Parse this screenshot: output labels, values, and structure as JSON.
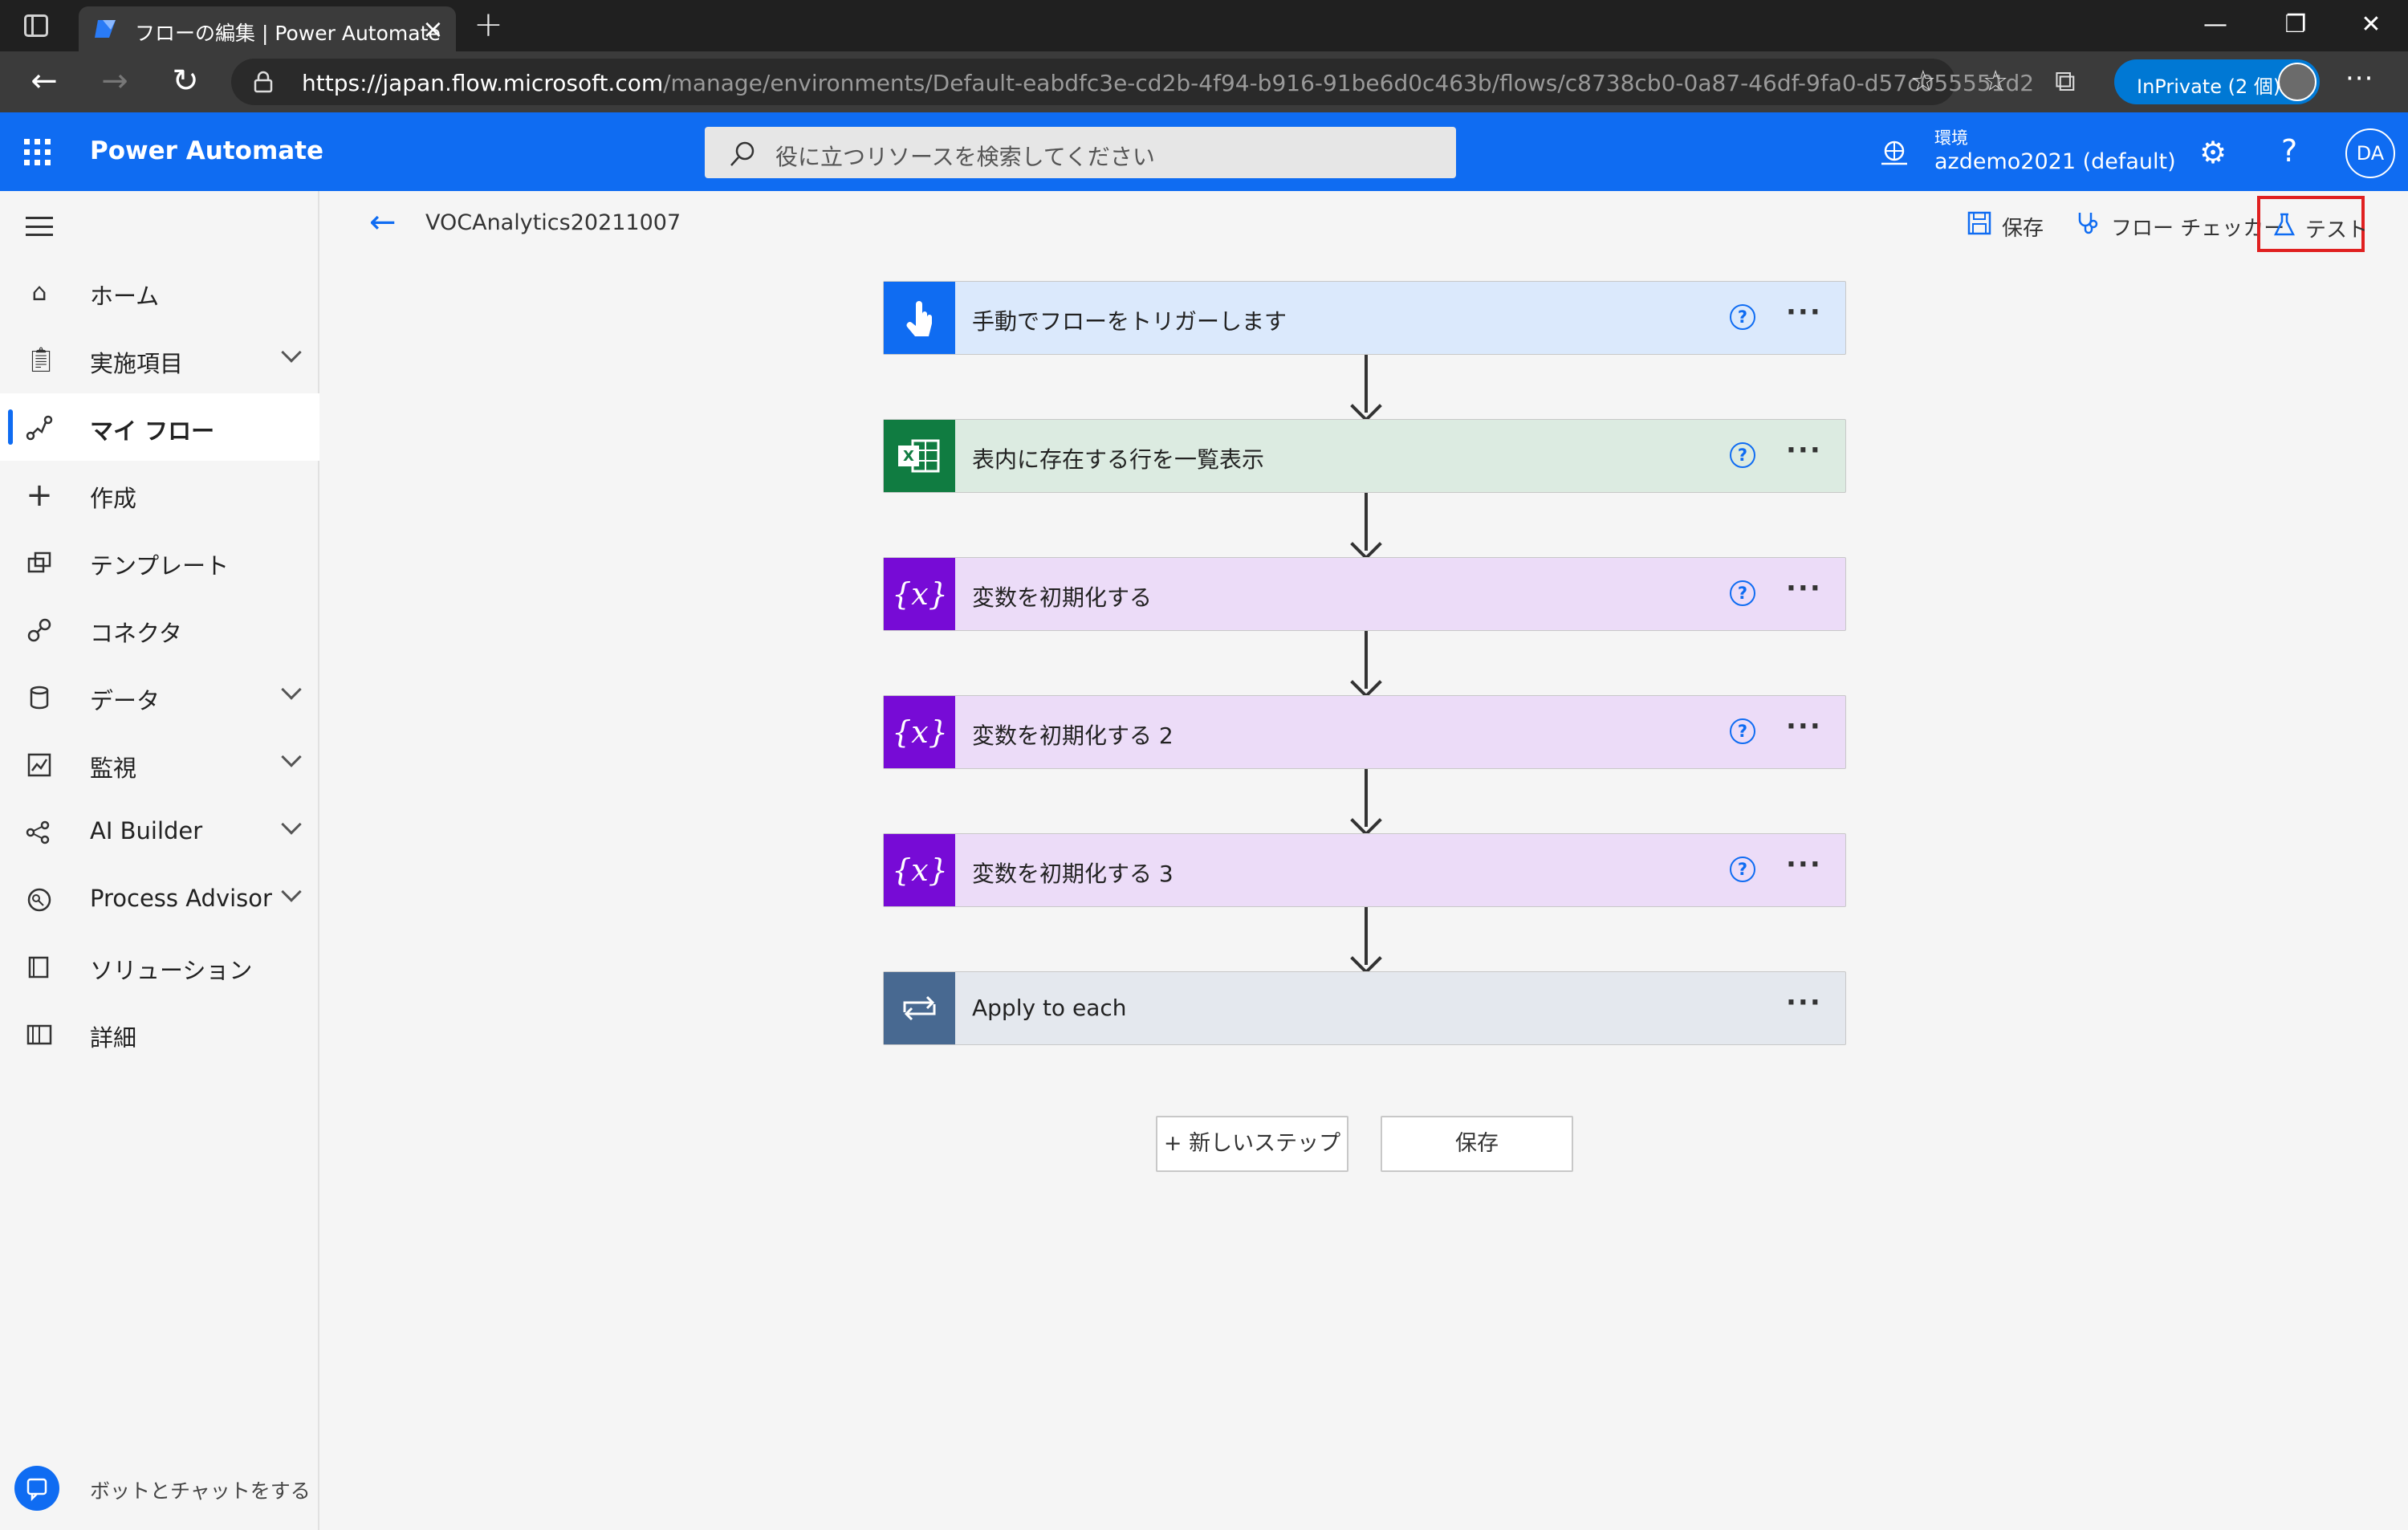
{
  "browser": {
    "tab_title": "フローの編集 | Power Automate",
    "url_host": "https://japan.flow.microsoft.com",
    "url_path": "/manage/environments/Default-eabdfc3e-cd2b-4f94-b916-91be6d0c463b/flows/c8738cb0-0a87-46df-9fa0-d57c055551d2",
    "inprivate_label": "InPrivate (2 個)"
  },
  "header": {
    "brand": "Power Automate",
    "search_placeholder": "役に立つリソースを検索してください",
    "env_label": "環境",
    "env_value": "azdemo2021 (default)",
    "user_initials": "DA"
  },
  "sidebar": {
    "items": [
      {
        "label": "ホーム",
        "icon": "home-icon"
      },
      {
        "label": "実施項目",
        "icon": "clipboard-icon"
      },
      {
        "label": "マイ フロー",
        "icon": "flow-icon"
      },
      {
        "label": "作成",
        "icon": "plus-icon"
      },
      {
        "label": "テンプレート",
        "icon": "template-icon"
      },
      {
        "label": "コネクタ",
        "icon": "connector-icon"
      },
      {
        "label": "データ",
        "icon": "database-icon"
      },
      {
        "label": "監視",
        "icon": "monitor-icon"
      },
      {
        "label": "AI Builder",
        "icon": "ai-builder-icon"
      },
      {
        "label": "Process Advisor",
        "icon": "process-advisor-icon"
      },
      {
        "label": "ソリューション",
        "icon": "solution-icon"
      },
      {
        "label": "詳細",
        "icon": "book-icon"
      }
    ],
    "chatbot_label": "ボットとチャットをする"
  },
  "cmdbar": {
    "flow_name": "VOCAnalytics20211007",
    "save_label": "保存",
    "checker_label": "フロー チェッカー",
    "test_label": "テスト"
  },
  "flow": {
    "steps": [
      {
        "title": "手動でフローをトリガーします",
        "icon": "touch-trigger-icon",
        "color": "#0f6cf2"
      },
      {
        "title": "表内に存在する行を一覧表示",
        "icon": "excel-icon",
        "color": "#107c41"
      },
      {
        "title": "変数を初期化する",
        "icon": "variable-icon",
        "color": "#770bd6"
      },
      {
        "title": "変数を初期化する 2",
        "icon": "variable-icon",
        "color": "#770bd6"
      },
      {
        "title": "変数を初期化する 3",
        "icon": "variable-icon",
        "color": "#770bd6"
      },
      {
        "title": "Apply to each",
        "icon": "loop-icon",
        "color": "#486991"
      }
    ],
    "new_step_label": "+ 新しいステップ",
    "save_button_label": "保存"
  },
  "colors": {
    "accent": "#0f6cf2",
    "test_highlight": "#e02020"
  }
}
